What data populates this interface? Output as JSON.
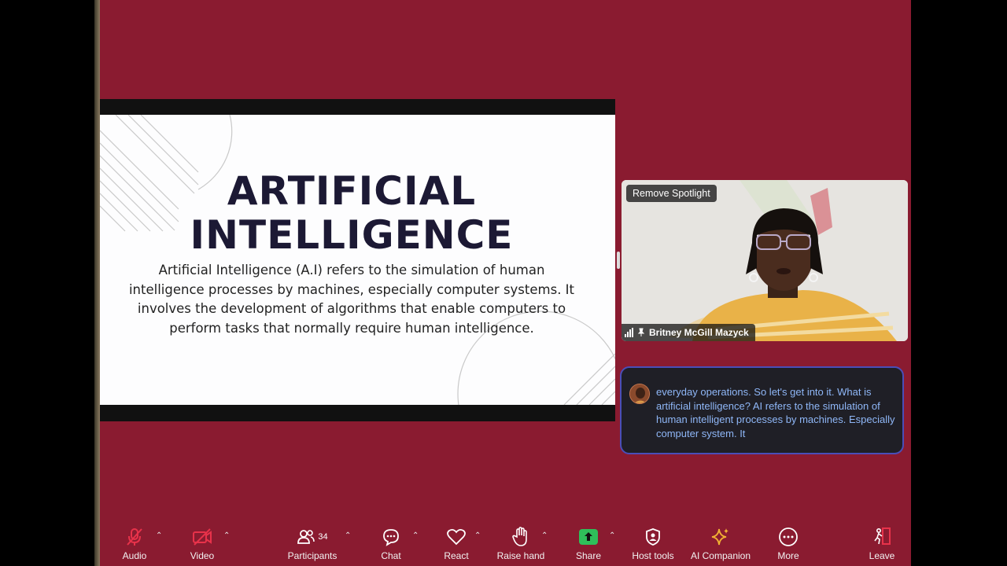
{
  "slide": {
    "title_line1": "ARTIFICIAL",
    "title_line2": "INTELLIGENCE",
    "body": "Artificial Intelligence (A.I) refers to the simulation of human intelligence processes by machines, especially computer systems. It involves the development of algorithms that enable computers to perform tasks that normally require human intelligence."
  },
  "video": {
    "spotlight_button": "Remove Spotlight",
    "participant_name": "Britney McGill Mazyck"
  },
  "caption": {
    "text": "everyday operations. So let's get into it. What is artificial intelligence? AI refers to the simulation of human intelligent processes by machines. Especially computer system. It"
  },
  "toolbar": {
    "audio": "Audio",
    "video": "Video",
    "participants": "Participants",
    "participants_count": "34",
    "chat": "Chat",
    "react": "React",
    "raise_hand": "Raise hand",
    "share": "Share",
    "host_tools": "Host tools",
    "ai_companion": "AI Companion",
    "more": "More",
    "leave": "Leave"
  },
  "colors": {
    "background": "#8a1b30",
    "muted_red": "#e8324a",
    "share_green": "#2fbf5a",
    "ai_gold": "#f2b233",
    "caption_text": "#8fb7f7",
    "caption_border": "#4a4eb8"
  },
  "icons": [
    "microphone-muted-icon",
    "video-off-icon",
    "participants-icon",
    "chat-icon",
    "heart-icon",
    "hand-icon",
    "share-up-arrow-icon",
    "shield-icon",
    "sparkle-icon",
    "ellipsis-icon",
    "leave-door-icon",
    "caret-up-icon",
    "signal-icon",
    "pin-icon"
  ]
}
